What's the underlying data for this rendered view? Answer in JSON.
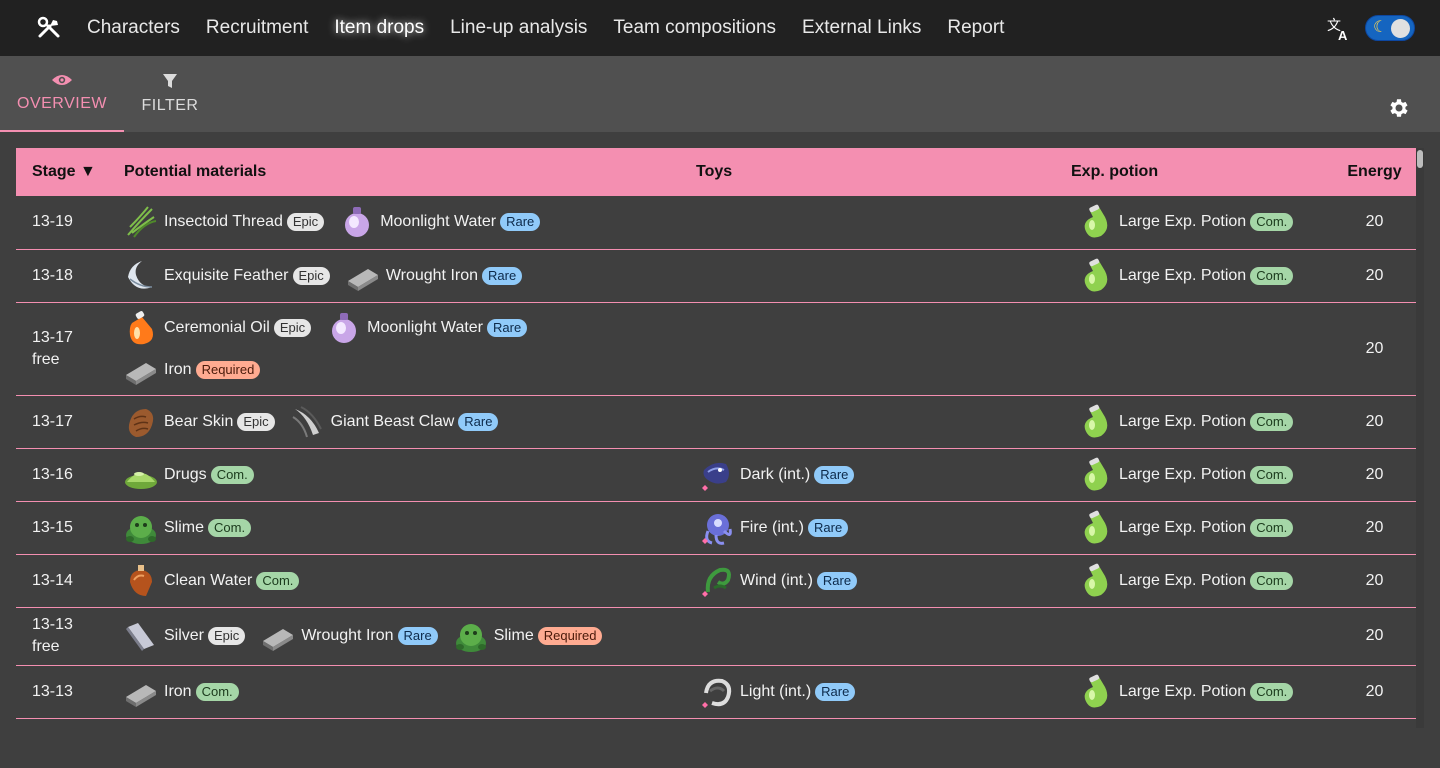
{
  "nav": {
    "items": [
      {
        "label": "Characters",
        "active": false
      },
      {
        "label": "Recruitment",
        "active": false
      },
      {
        "label": "Item drops",
        "active": true
      },
      {
        "label": "Line-up analysis",
        "active": false
      },
      {
        "label": "Team compositions",
        "active": false
      },
      {
        "label": "External Links",
        "active": false
      },
      {
        "label": "Report",
        "active": false
      }
    ],
    "logo_icon": "tools-icon",
    "language_icon": "translate-icon",
    "theme_toggle": {
      "icon": "moon-icon",
      "dark": true
    }
  },
  "tabs": {
    "overview": {
      "label": "OVERVIEW",
      "icon": "eye-icon",
      "active": true
    },
    "filter": {
      "label": "FILTER",
      "icon": "filter-icon",
      "active": false
    },
    "settings_icon": "gear-icon"
  },
  "colors": {
    "accent": "#f48fb1",
    "epic": "#e6e6e6",
    "rare": "#90caf9",
    "com": "#a5d6a7",
    "required": "#ffab91"
  },
  "table": {
    "headers": {
      "stage": "Stage ▼",
      "materials": "Potential materials",
      "toys": "Toys",
      "potion": "Exp. potion",
      "energy": "Energy"
    },
    "rows": [
      {
        "stage": "13-19",
        "free": "",
        "materials": [
          {
            "name": "Insectoid Thread",
            "badge": "Epic",
            "icon": "thread-icon"
          },
          {
            "name": "Moonlight Water",
            "badge": "Rare",
            "icon": "moon-water-icon"
          }
        ],
        "toy": null,
        "potion": {
          "name": "Large Exp. Potion",
          "badge": "Com.",
          "icon": "potion-icon"
        },
        "energy": "20"
      },
      {
        "stage": "13-18",
        "free": "",
        "materials": [
          {
            "name": "Exquisite Feather",
            "badge": "Epic",
            "icon": "feather-icon"
          },
          {
            "name": "Wrought Iron",
            "badge": "Rare",
            "icon": "iron-bar-icon"
          }
        ],
        "toy": null,
        "potion": {
          "name": "Large Exp. Potion",
          "badge": "Com.",
          "icon": "potion-icon"
        },
        "energy": "20"
      },
      {
        "stage": "13-17",
        "free": "free",
        "materials": [
          {
            "name": "Ceremonial Oil",
            "badge": "Epic",
            "icon": "oil-icon"
          },
          {
            "name": "Moonlight Water",
            "badge": "Rare",
            "icon": "moon-water-icon"
          },
          {
            "name": "Iron",
            "badge": "Required",
            "icon": "iron-bar-icon"
          }
        ],
        "toy": null,
        "potion": null,
        "energy": "20"
      },
      {
        "stage": "13-17",
        "free": "",
        "materials": [
          {
            "name": "Bear Skin",
            "badge": "Epic",
            "icon": "skin-icon"
          },
          {
            "name": "Giant Beast Claw",
            "badge": "Rare",
            "icon": "claw-icon"
          }
        ],
        "toy": null,
        "potion": {
          "name": "Large Exp. Potion",
          "badge": "Com.",
          "icon": "potion-icon"
        },
        "energy": "20"
      },
      {
        "stage": "13-16",
        "free": "",
        "materials": [
          {
            "name": "Drugs",
            "badge": "Com.",
            "icon": "drugs-icon"
          }
        ],
        "toy": {
          "name": "Dark (int.)",
          "badge": "Rare",
          "icon": "dark-toy-icon"
        },
        "potion": {
          "name": "Large Exp. Potion",
          "badge": "Com.",
          "icon": "potion-icon"
        },
        "energy": "20"
      },
      {
        "stage": "13-15",
        "free": "",
        "materials": [
          {
            "name": "Slime",
            "badge": "Com.",
            "icon": "slime-icon"
          }
        ],
        "toy": {
          "name": "Fire (int.)",
          "badge": "Rare",
          "icon": "fire-toy-icon"
        },
        "potion": {
          "name": "Large Exp. Potion",
          "badge": "Com.",
          "icon": "potion-icon"
        },
        "energy": "20"
      },
      {
        "stage": "13-14",
        "free": "",
        "materials": [
          {
            "name": "Clean Water",
            "badge": "Com.",
            "icon": "water-icon"
          }
        ],
        "toy": {
          "name": "Wind (int.)",
          "badge": "Rare",
          "icon": "wind-toy-icon"
        },
        "potion": {
          "name": "Large Exp. Potion",
          "badge": "Com.",
          "icon": "potion-icon"
        },
        "energy": "20"
      },
      {
        "stage": "13-13",
        "free": "free",
        "materials": [
          {
            "name": "Silver",
            "badge": "Epic",
            "icon": "silver-icon"
          },
          {
            "name": "Wrought Iron",
            "badge": "Rare",
            "icon": "iron-bar-icon"
          },
          {
            "name": "Slime",
            "badge": "Required",
            "icon": "slime-icon"
          }
        ],
        "toy": null,
        "potion": null,
        "energy": "20"
      },
      {
        "stage": "13-13",
        "free": "",
        "materials": [
          {
            "name": "Iron",
            "badge": "Com.",
            "icon": "iron-bar-icon"
          }
        ],
        "toy": {
          "name": "Light (int.)",
          "badge": "Rare",
          "icon": "light-toy-icon"
        },
        "potion": {
          "name": "Large Exp. Potion",
          "badge": "Com.",
          "icon": "potion-icon"
        },
        "energy": "20"
      }
    ]
  }
}
